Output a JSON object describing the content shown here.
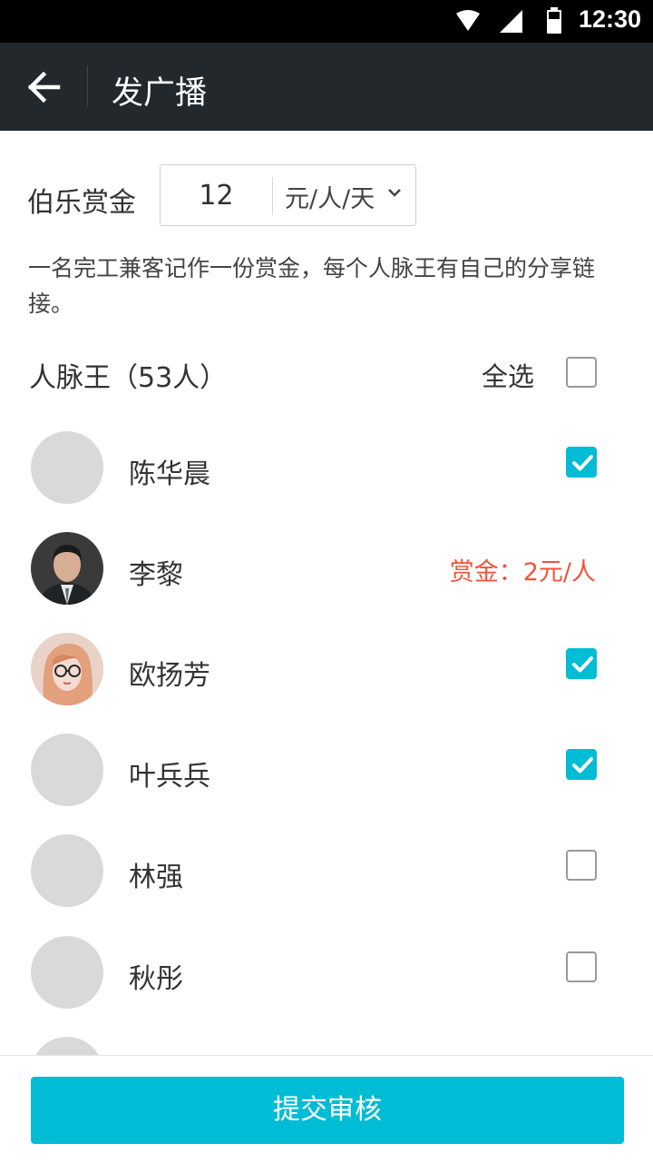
{
  "status_bar": {
    "time": "12:30",
    "icons": [
      "wifi-icon",
      "signal-icon",
      "battery-icon"
    ]
  },
  "app_bar": {
    "title": "发广播",
    "back_icon": "arrow-left-icon"
  },
  "reward": {
    "label": "伯乐赏金",
    "value": "12",
    "unit": "元/人/天"
  },
  "description": "一名完工兼客记作一份赏金，每个人脉王有自己的分享链接。",
  "section": {
    "title": "人脉王（53人）",
    "select_all_label": "全选",
    "select_all_checked": false
  },
  "contacts": [
    {
      "name": "陈华晨",
      "avatar": "placeholder",
      "checked": true
    },
    {
      "name": "李黎",
      "avatar": "photo-male",
      "bounty": "赏金：2元/人"
    },
    {
      "name": "欧扬芳",
      "avatar": "photo-female",
      "checked": true
    },
    {
      "name": "叶兵兵",
      "avatar": "placeholder",
      "checked": true
    },
    {
      "name": "林强",
      "avatar": "placeholder",
      "checked": false
    },
    {
      "name": "秋彤",
      "avatar": "placeholder",
      "checked": false
    }
  ],
  "submit_label": "提交审核",
  "colors": {
    "accent": "#00bcd4",
    "app_bar": "#22282b",
    "bounty": "#f0553a",
    "avatar_placeholder": "#d9d9d9"
  }
}
